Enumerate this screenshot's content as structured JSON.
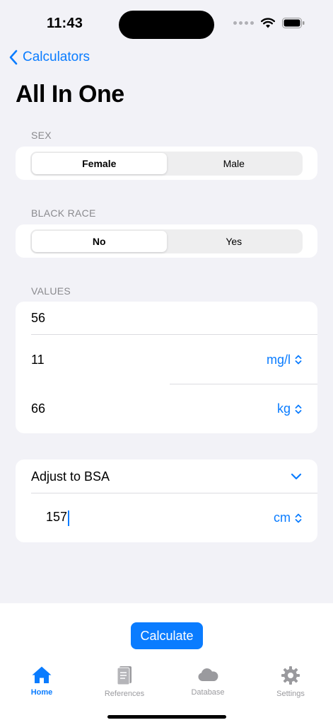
{
  "status_bar": {
    "time": "11:43"
  },
  "nav": {
    "back_label": "Calculators",
    "title": "All In One"
  },
  "sex": {
    "section_label": "SEX",
    "options": [
      {
        "label": "Female",
        "selected": true
      },
      {
        "label": "Male",
        "selected": false
      }
    ]
  },
  "black_race": {
    "section_label": "BLACK RACE",
    "options": [
      {
        "label": "No",
        "selected": true
      },
      {
        "label": "Yes",
        "selected": false
      }
    ]
  },
  "values": {
    "section_label": "VALUES",
    "rows": [
      {
        "value": "56",
        "unit": ""
      },
      {
        "value": "11",
        "unit": "mg/l"
      },
      {
        "value": "66",
        "unit": "kg"
      }
    ]
  },
  "bsa": {
    "label": "Adjust to BSA",
    "height_value": "157",
    "height_unit": "cm"
  },
  "actions": {
    "calculate_label": "Calculate"
  },
  "tabbar": {
    "items": [
      {
        "label": "Home",
        "icon": "house-icon",
        "active": true
      },
      {
        "label": "References",
        "icon": "book-icon",
        "active": false
      },
      {
        "label": "Database",
        "icon": "cloud-icon",
        "active": false
      },
      {
        "label": "Settings",
        "icon": "gear-icon",
        "active": false
      }
    ]
  },
  "colors": {
    "accent": "#0a7cff",
    "background": "#f2f2f7",
    "inactive_tab": "#9a9a9e"
  }
}
